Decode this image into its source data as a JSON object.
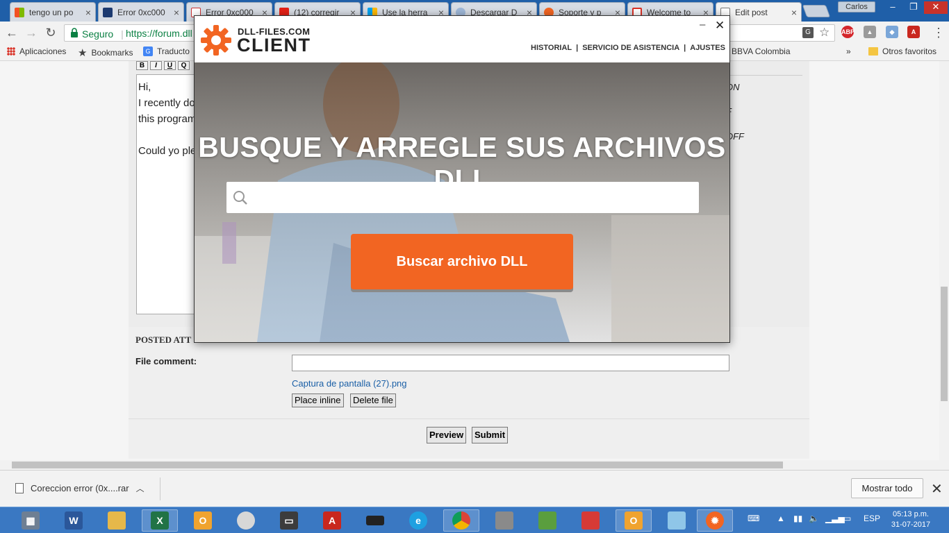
{
  "tabs": [
    {
      "title": "tengo un po",
      "color": "#f25022"
    },
    {
      "title": "Error 0xc000",
      "color": "#1c3a70"
    },
    {
      "title": "Error 0xc000",
      "color": "#ffffff"
    },
    {
      "title": "(12) corregir",
      "color": "#e62117"
    },
    {
      "title": "Use la herra",
      "color": "#00a4ef"
    },
    {
      "title": "Descargar D",
      "color": "#1e90ff"
    },
    {
      "title": "Soporte y p",
      "color": "#f26522"
    },
    {
      "title": "Welcome to",
      "color": "#d93025"
    },
    {
      "title": "Edit post",
      "color": "#ffffff"
    }
  ],
  "profile_name": "Carlos",
  "address": {
    "secure_label": "Seguro",
    "url": "https://forum.dll"
  },
  "bookmarks": {
    "apps": "Aplicaciones",
    "bookmarks": "Bookmarks",
    "translator": "Traducto",
    "bbva": "BBVA Colombia",
    "more": "»",
    "other": "Otros favoritos"
  },
  "editor": {
    "toolbar": [
      "B",
      "I",
      "U",
      "Q"
    ],
    "lines": [
      "Hi,",
      "I recently do",
      "this program",
      "",
      "Could yo ple"
    ]
  },
  "side_options": [
    "ON",
    "F",
    "OFF"
  ],
  "attachments": {
    "heading": "POSTED ATT",
    "file_comment_label": "File comment:",
    "file_link": "Captura de pantalla (27).png",
    "place_inline": "Place inline",
    "delete_file": "Delete file",
    "preview": "Preview",
    "submit": "Submit"
  },
  "popup": {
    "brand_top": "DLL-FILES.COM",
    "brand_main": "CLIENT",
    "nav": [
      "HISTORIAL",
      "SERVICIO DE ASISTENCIA",
      "AJUSTES"
    ],
    "hero_title": "BUSQUE Y ARREGLE SUS ARCHIVOS DLL",
    "search_placeholder": "",
    "search_button": "Buscar archivo DLL",
    "accent_color": "#f26522"
  },
  "download_bar": {
    "file": "Coreccion error (0x....rar",
    "show_all": "Mostrar todo"
  },
  "taskbar": {
    "language": "ESP",
    "time": "05:13 p.m.",
    "date": "31-07-2017"
  }
}
